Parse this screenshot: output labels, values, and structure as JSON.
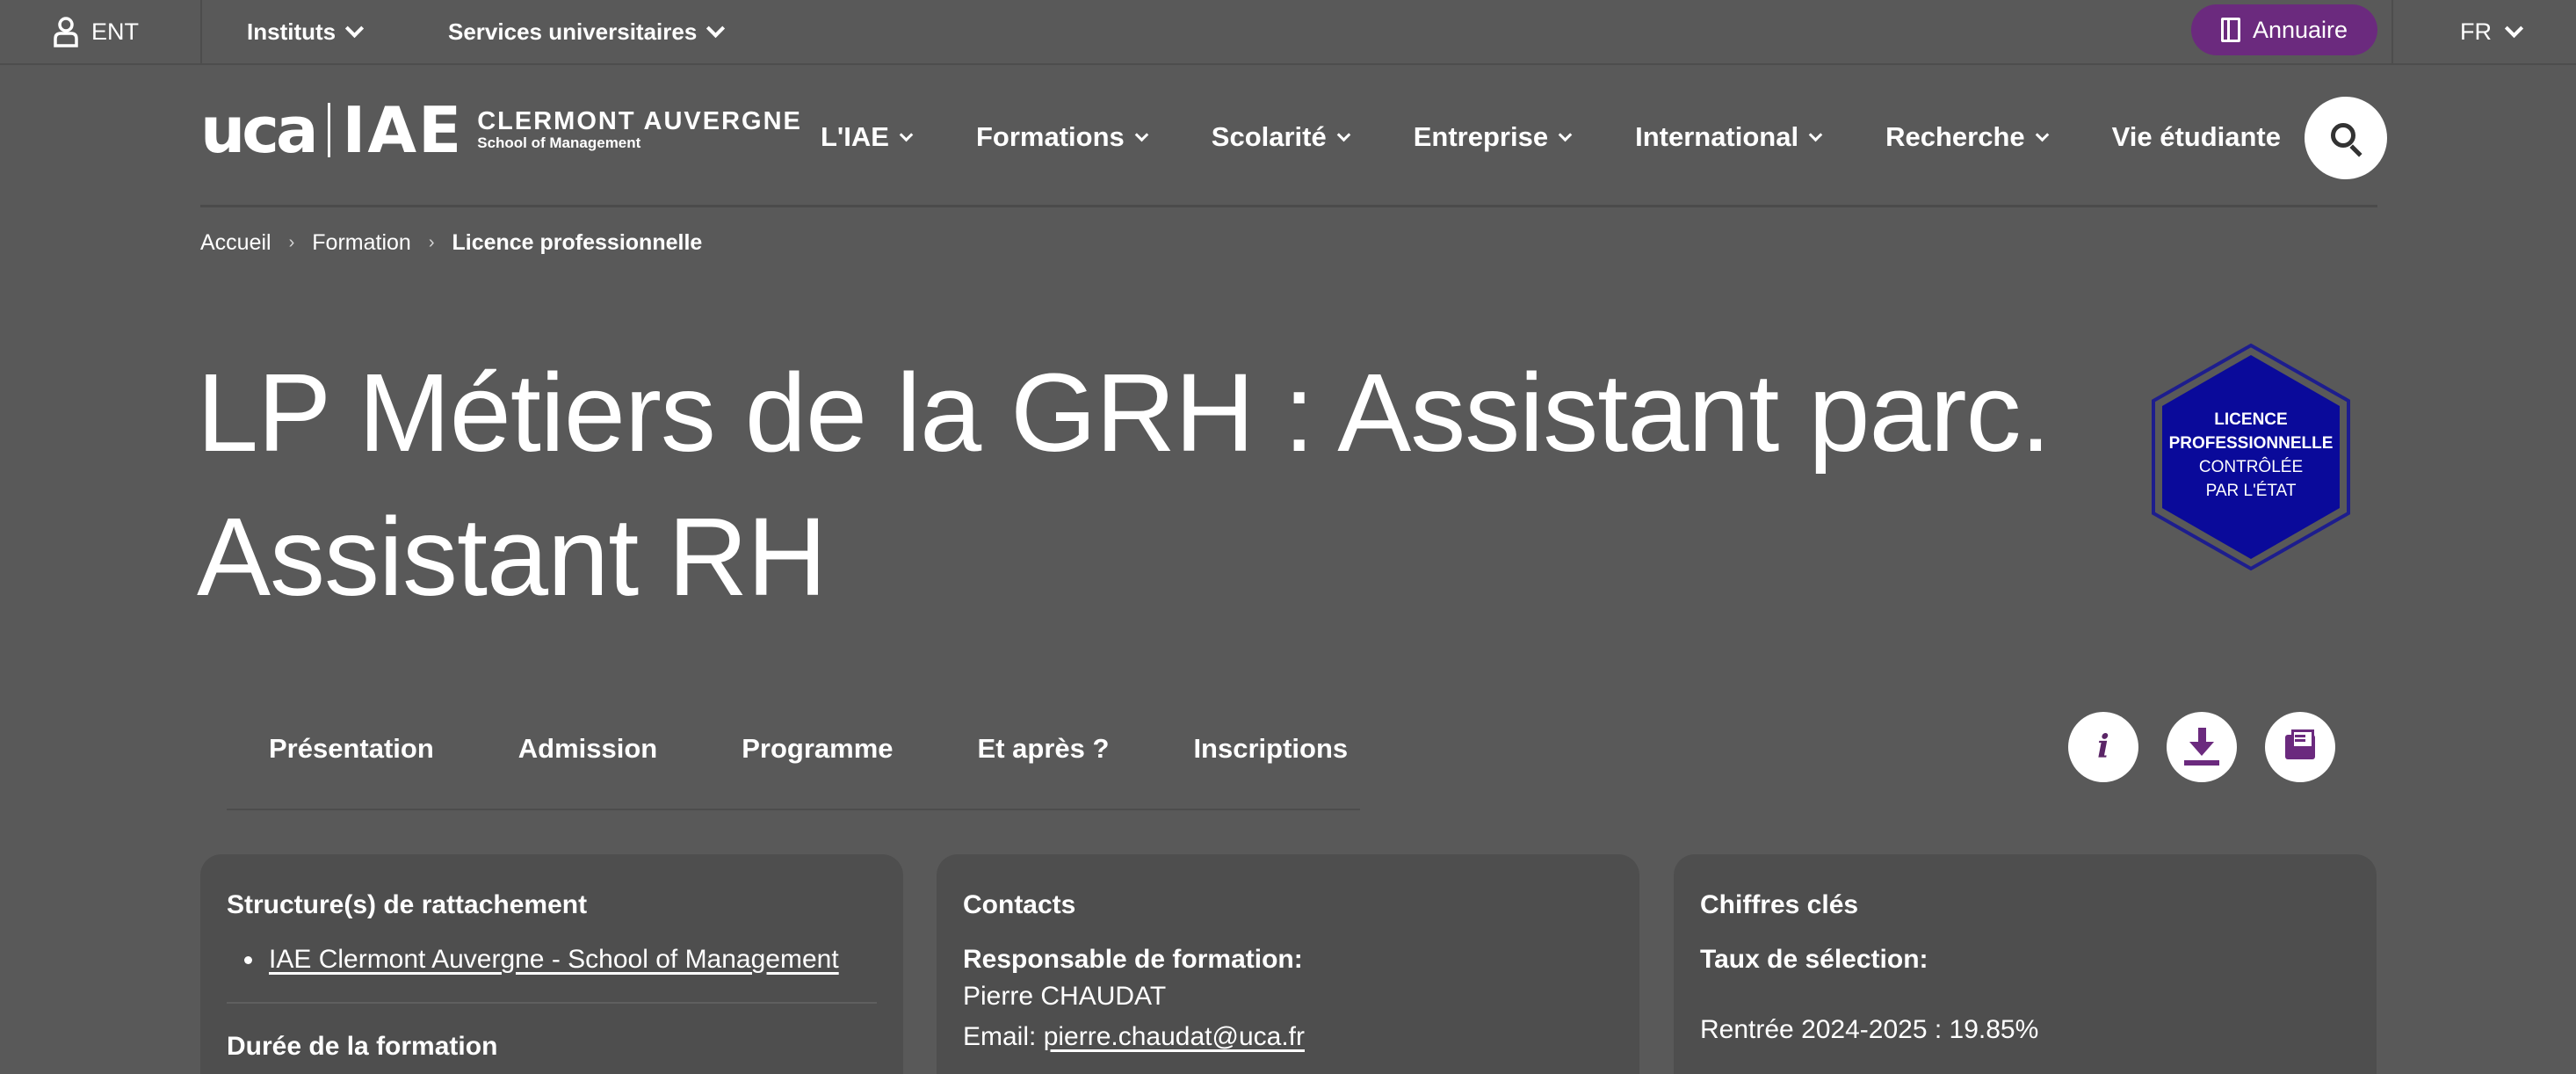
{
  "topbar": {
    "ent_label": "ENT",
    "institutes_label": "Instituts",
    "services_label": "Services universitaires",
    "directory_label": "Annuaire",
    "language_label": "FR"
  },
  "logo": {
    "uca": "uca",
    "iae": "IAE",
    "line1": "CLERMONT AUVERGNE",
    "line2": "School of Management"
  },
  "nav": {
    "items": [
      {
        "label": "L'IAE"
      },
      {
        "label": "Formations"
      },
      {
        "label": "Scolarité"
      },
      {
        "label": "Entreprise"
      },
      {
        "label": "International"
      },
      {
        "label": "Recherche"
      },
      {
        "label": "Vie étudiante"
      }
    ]
  },
  "breadcrumb": {
    "items": [
      "Accueil",
      "Formation",
      "Licence professionnelle"
    ],
    "separator": "›"
  },
  "page": {
    "title": "LP Métiers de la GRH : Assistant parc. Assistant RH"
  },
  "badge": {
    "line1": "LICENCE",
    "line2": "PROFESSIONNELLE",
    "line3": "CONTRÔLÉE",
    "line4": "PAR L'ÉTAT"
  },
  "tabs": [
    "Présentation",
    "Admission",
    "Programme",
    "Et après ?",
    "Inscriptions"
  ],
  "actions": {
    "info_glyph": "i",
    "info_icon": "info-icon",
    "download_icon": "download-icon",
    "contact_icon": "mail-icon"
  },
  "cards": {
    "structure": {
      "title": "Structure(s) de rattachement",
      "link": "IAE Clermont Auvergne - School of Management",
      "duration_title": "Durée de la formation"
    },
    "contacts": {
      "title": "Contacts",
      "manager_label": "Responsable de formation:",
      "manager_name": "Pierre CHAUDAT",
      "email_prefix": "Email:",
      "email": "pierre.chaudat@uca.fr"
    },
    "figures": {
      "title": "Chiffres clés",
      "rate_label": "Taux de sélection:",
      "rate_value": "Rentrée 2024-2025 : 19.85%"
    }
  },
  "colors": {
    "background": "#595959",
    "card": "#4e4e4e",
    "accent": "#6b2a7e",
    "badge_fill": "#0a0a9a",
    "badge_border": "#1a1a8a"
  }
}
